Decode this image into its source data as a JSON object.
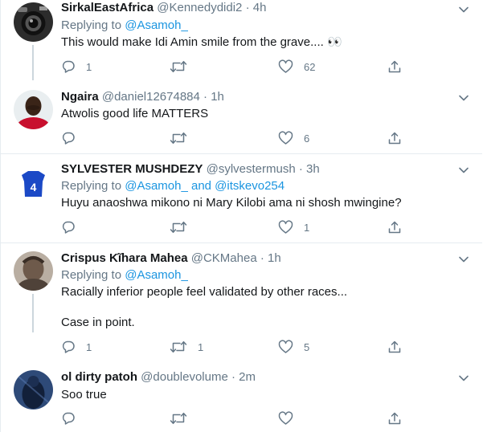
{
  "tweets": [
    {
      "name": "SirkalEastAfrica",
      "handle": "@Kennedydidi2",
      "time": "4h",
      "replying_prefix": "Replying to",
      "replying_to": "@Asamoh_",
      "text_lines": [
        "This would make Idi Amin smile from the grave.... 👀"
      ],
      "reply_count": "1",
      "retweet_count": "",
      "like_count": "62"
    },
    {
      "name": "Ngaira",
      "handle": "@daniel12674884",
      "time": "1h",
      "text_lines": [
        "Atwolis good life MATTERS"
      ],
      "reply_count": "",
      "retweet_count": "",
      "like_count": "6"
    },
    {
      "name": "SYLVESTER MUSHDEZY",
      "handle": "@sylvestermush",
      "time": "3h",
      "replying_prefix": "Replying to",
      "replying_to": "@Asamoh_ and @itskevo254",
      "text_lines": [
        "Huyu anaoshwa mikono ni Mary Kilobi ama ni shosh mwingine?"
      ],
      "reply_count": "",
      "retweet_count": "",
      "like_count": "1"
    },
    {
      "name": "Crispus Kĩhara Mahea",
      "handle": "@CKMahea",
      "time": "1h",
      "replying_prefix": "Replying to",
      "replying_to": "@Asamoh_",
      "text_lines": [
        "Racially inferior people feel validated by other races...",
        "Case in point."
      ],
      "reply_count": "1",
      "retweet_count": "1",
      "like_count": "5"
    },
    {
      "name": "ol dirty patoh",
      "handle": "@doublevolume",
      "time": "2m",
      "text_lines": [
        "Soo true"
      ],
      "reply_count": "",
      "retweet_count": "",
      "like_count": ""
    }
  ],
  "icons": {
    "reply": "reply-icon",
    "retweet": "retweet-icon",
    "like": "heart-icon",
    "share": "share-icon",
    "more": "chevron-down-icon"
  },
  "colors": {
    "link": "#1b95e0",
    "secondary_text": "#657786",
    "divider": "#e6ecf0",
    "thread_line": "#ccd6dd"
  }
}
